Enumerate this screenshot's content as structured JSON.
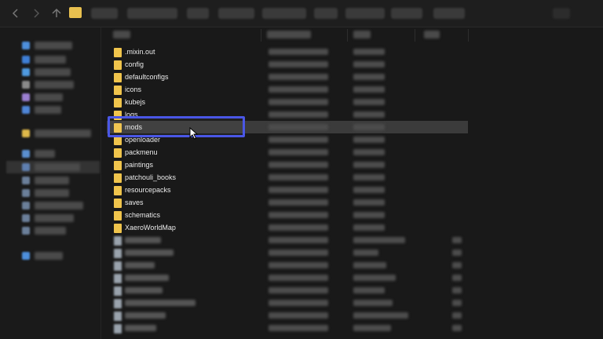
{
  "folders": [
    {
      "name": ".mixin.out"
    },
    {
      "name": "config"
    },
    {
      "name": "defaultconfigs"
    },
    {
      "name": "icons"
    },
    {
      "name": "kubejs"
    },
    {
      "name": "logs"
    },
    {
      "name": "mods"
    },
    {
      "name": "openloader"
    },
    {
      "name": "packmenu"
    },
    {
      "name": "paintings"
    },
    {
      "name": "patchouli_books"
    },
    {
      "name": "resourcepacks"
    },
    {
      "name": "saves"
    },
    {
      "name": "schematics"
    },
    {
      "name": "XaeroWorldMap"
    }
  ],
  "highlighted_folder": "mods",
  "colors": {
    "highlight_border": "#4a57e6",
    "folder": "#f0c44c",
    "background": "#191919",
    "row_hover": "#3b3b3b"
  },
  "icons": {
    "back": "arrow-left-icon",
    "forward": "arrow-right-icon",
    "up": "arrow-up-icon",
    "cursor": "mouse-pointer-icon"
  }
}
